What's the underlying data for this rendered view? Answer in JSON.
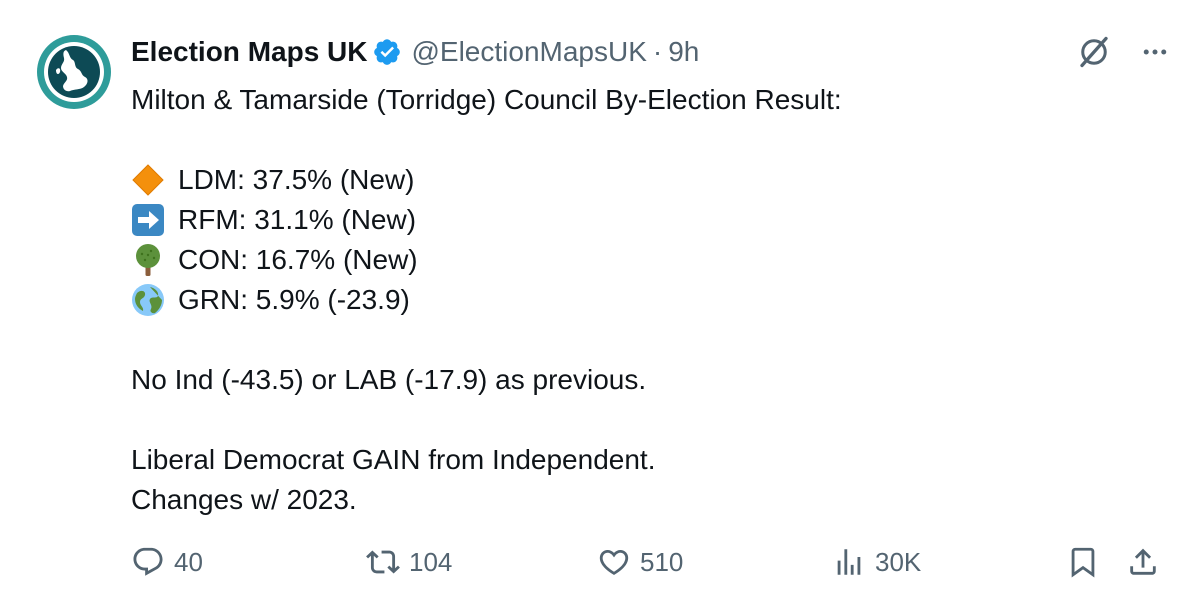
{
  "author": {
    "display_name": "Election Maps UK",
    "handle": "@ElectionMapsUK",
    "separator": "·",
    "time": "9h",
    "verified": true,
    "avatar_icon": "election-maps-logo-icon"
  },
  "tweet": {
    "lines": [
      "Milton & Tamarside (Torridge) Council By-Election Result:",
      "",
      "LDM: 37.5% (New)",
      "RFM: 31.1% (New)",
      "CON: 16.7% (New)",
      "GRN: 5.9% (-23.9)",
      "",
      "No Ind (-43.5) or LAB (-17.9) as previous.",
      "",
      "Liberal Democrat GAIN from Independent.",
      "Changes w/ 2023."
    ],
    "results": [
      {
        "emoji": "orange-diamond-icon",
        "text": "LDM: 37.5% (New)"
      },
      {
        "emoji": "right-arrow-icon",
        "text": "RFM: 31.1% (New)"
      },
      {
        "emoji": "tree-icon",
        "text": "CON: 16.7% (New)"
      },
      {
        "emoji": "globe-icon",
        "text": "GRN: 5.9% (-23.9)"
      }
    ],
    "headline": "Milton & Tamarside (Torridge) Council By-Election Result:",
    "note": "No Ind (-43.5) or LAB (-17.9) as previous.",
    "conclusion": "Liberal Democrat GAIN from Independent.",
    "changes": "Changes w/ 2023."
  },
  "stats": {
    "replies": "40",
    "retweets": "104",
    "likes": "510",
    "views": "30K"
  },
  "colors": {
    "text": "#0f1419",
    "secondary": "#536471",
    "verified_blue": "#1d9bf0",
    "avatar_teal": "#2e9c9a"
  }
}
